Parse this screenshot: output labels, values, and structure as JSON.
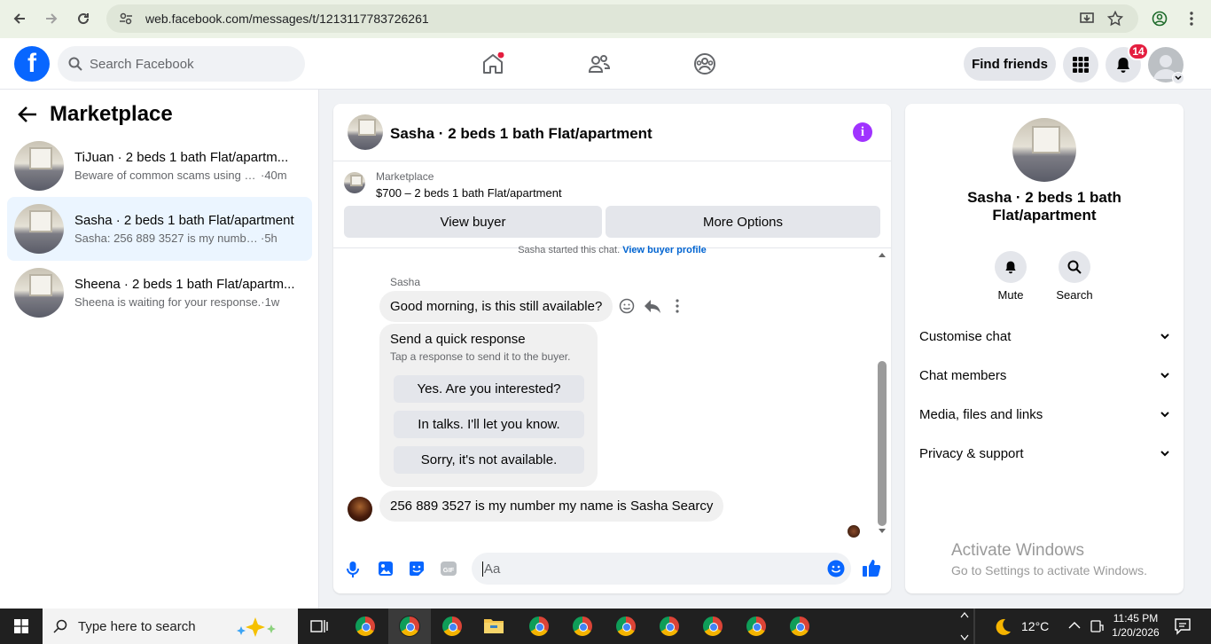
{
  "browser": {
    "url": "web.facebook.com/messages/t/1213117783726261"
  },
  "header": {
    "logo": "f",
    "search_placeholder": "Search Facebook",
    "find_friends": "Find friends",
    "notification_count": "14"
  },
  "sidebar": {
    "title": "Marketplace",
    "conversations": [
      {
        "name": "TiJuan · 2 beds 1 bath Flat/apartm...",
        "preview": "Beware of common scams using pa...",
        "time": "·40m",
        "active": false
      },
      {
        "name": "Sasha · 2 beds 1 bath Flat/apartment",
        "preview": "Sasha: 256 889 3527 is my number m...",
        "time": "·5h",
        "active": true
      },
      {
        "name": "Sheena · 2 beds 1 bath Flat/apartm...",
        "preview": "Sheena is waiting for your response.",
        "time": "·1w",
        "active": false
      }
    ]
  },
  "chat": {
    "title": "Sasha · 2 beds 1 bath Flat/apartment",
    "listing_source": "Marketplace",
    "listing_price": "$700 – 2 beds 1 bath Flat/apartment",
    "view_buyer": "View buyer",
    "more_options": "More Options",
    "started_text": "Sasha started this chat.",
    "view_buyer_profile": "View buyer profile",
    "sender_name": "Sasha",
    "message_1": "Good morning, is this still available?",
    "quick_response_title": "Send a quick response",
    "quick_response_sub": "Tap a response to send it to the buyer.",
    "quick_responses": [
      "Yes. Are you interested?",
      "In talks. I'll let you know.",
      "Sorry, it's not available."
    ],
    "message_2": "256 889 3527 is my number my name is Sasha Searcy",
    "input_placeholder": "Aa"
  },
  "details": {
    "name": "Sasha · 2 beds 1 bath Flat/apartment",
    "mute": "Mute",
    "search": "Search",
    "sections": [
      "Customise chat",
      "Chat members",
      "Media, files and links",
      "Privacy & support"
    ]
  },
  "watermark": {
    "line1": "Activate Windows",
    "line2": "Go to Settings to activate Windows."
  },
  "taskbar": {
    "search_placeholder": "Type here to search",
    "temperature": "12°C",
    "time": "11:45 PM",
    "date": "1/20/2026"
  },
  "colors": {
    "brand": "#0866ff",
    "active_conversation": "#ebf5ff",
    "info_icon": "#a033ff",
    "badge": "#e41e3f"
  }
}
